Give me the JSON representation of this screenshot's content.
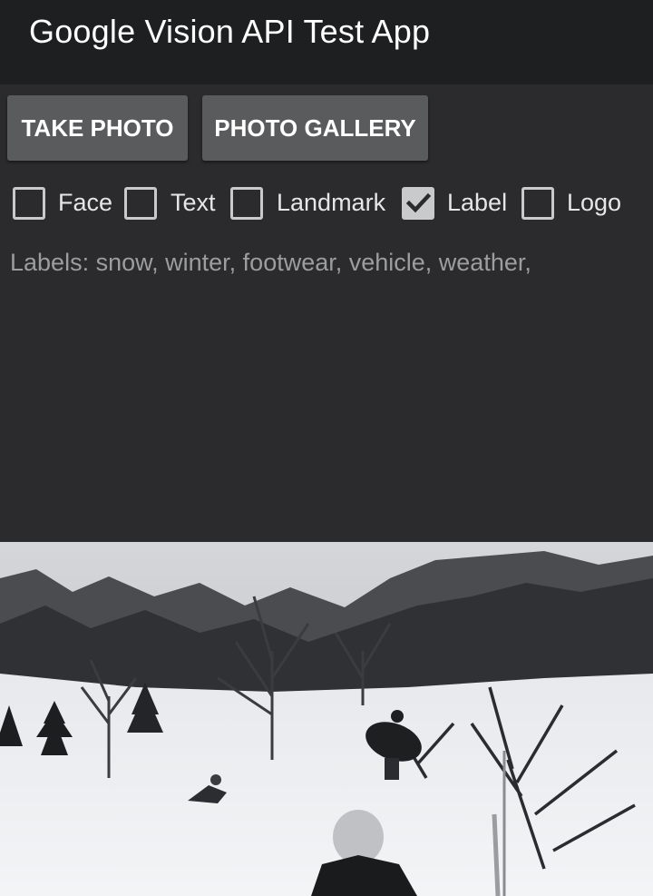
{
  "app": {
    "title": "Google Vision API Test App"
  },
  "buttons": {
    "take_photo": "TAKE PHOTO",
    "photo_gallery": "PHOTO GALLERY"
  },
  "options": [
    {
      "label": "Face",
      "checked": false
    },
    {
      "label": "Text",
      "checked": false
    },
    {
      "label": "Landmark",
      "checked": false
    },
    {
      "label": "Label",
      "checked": true
    },
    {
      "label": "Logo",
      "checked": false
    }
  ],
  "results": {
    "prefix": "Labels:",
    "values": "snow, winter, footwear, vehicle, weather,"
  },
  "colors": {
    "background": "#2b2b2d",
    "appbar": "#1e1f20",
    "button": "#5a5b5d",
    "checkbox": "#c9cacb",
    "result_text": "#9c9d9f"
  }
}
